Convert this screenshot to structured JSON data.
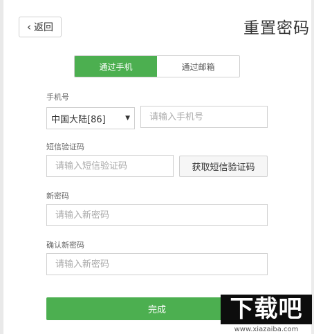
{
  "header": {
    "back_label": "返回",
    "title": "重置密码"
  },
  "tabs": [
    {
      "label": "通过手机",
      "active": true
    },
    {
      "label": "通过邮箱",
      "active": false
    }
  ],
  "form": {
    "phone_label": "手机号",
    "region_select_value": "中国大陆[86]",
    "phone_placeholder": "请输入手机号",
    "sms_label": "短信验证码",
    "sms_placeholder": "请输入短信验证码",
    "get_code_label": "获取短信验证码",
    "new_password_label": "新密码",
    "new_password_placeholder": "请输入新密码",
    "confirm_password_label": "确认新密码",
    "confirm_password_placeholder": "请输入新密码",
    "submit_label": "完成"
  },
  "watermark": {
    "text": "下载吧",
    "url": "www.xiazaiba.com"
  },
  "colors": {
    "accent": "#4caf50"
  }
}
